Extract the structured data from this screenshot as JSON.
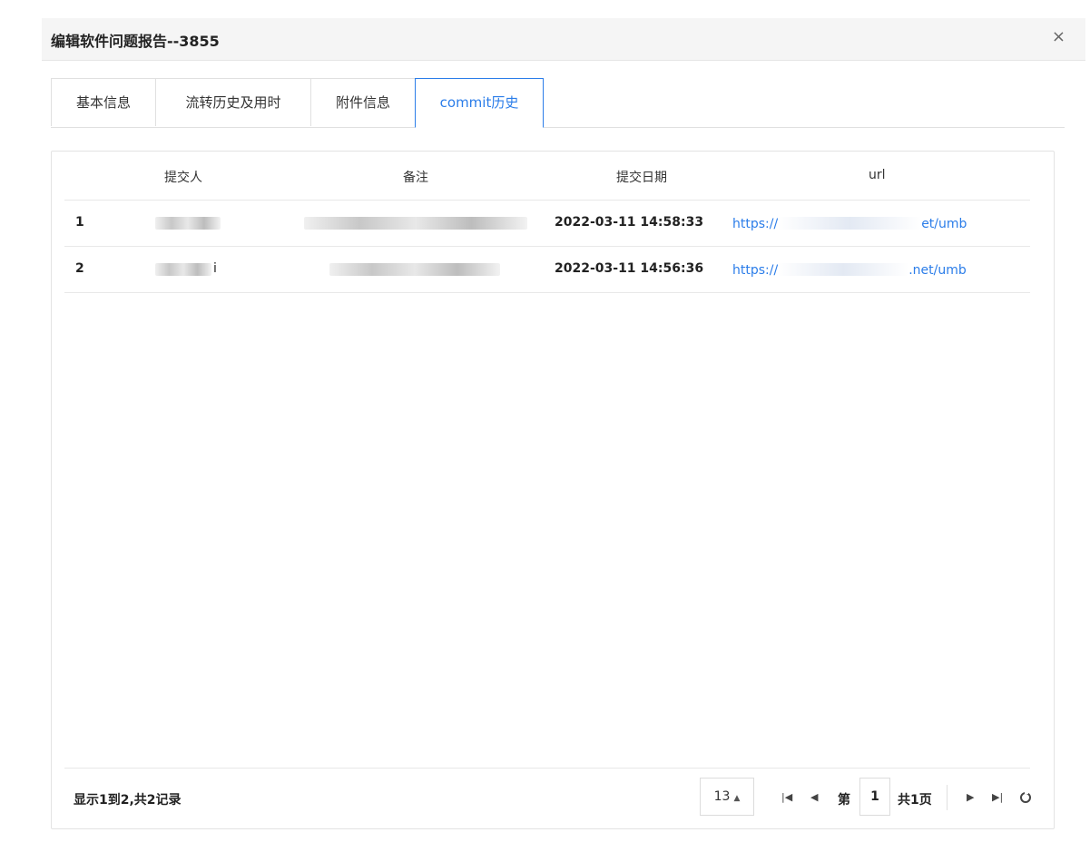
{
  "dialog": {
    "title": "编辑软件问题报告--3855",
    "close_glyph": "×"
  },
  "tabs": [
    {
      "label": "基本信息",
      "active": false
    },
    {
      "label": "流转历史及用时",
      "active": false
    },
    {
      "label": "附件信息",
      "active": false
    },
    {
      "label": "commit历史",
      "active": true
    }
  ],
  "table": {
    "columns": [
      "提交人",
      "备注",
      "提交日期",
      "url"
    ],
    "rows": [
      {
        "index": "1",
        "committer": "",
        "note": "",
        "date": "2022-03-11 14:58:33",
        "url_prefix": "https://",
        "url_suffix": "et/umb"
      },
      {
        "index": "2",
        "committer": "i",
        "note": "",
        "date": "2022-03-11 14:56:36",
        "url_prefix": "https://",
        "url_suffix": ".net/umb"
      }
    ]
  },
  "footer": {
    "summary": "显示1到2,共2记录",
    "page_size": "13",
    "page_prefix": "第",
    "current_page": "1",
    "page_total": "共1页"
  },
  "colors": {
    "accent": "#2b7de9",
    "header_bg": "#f5f5f5"
  },
  "icons": [
    "close-icon",
    "first-page-icon",
    "prev-page-icon",
    "next-page-icon",
    "last-page-icon",
    "refresh-icon",
    "caret-up-icon"
  ]
}
